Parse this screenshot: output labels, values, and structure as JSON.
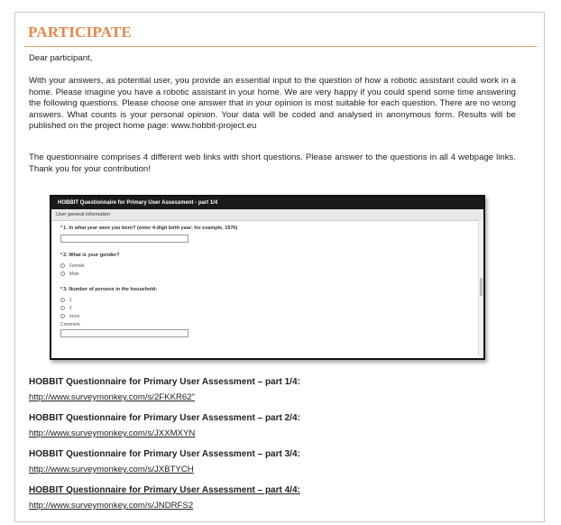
{
  "page": {
    "heading": "PARTICIPATE",
    "greeting": "Dear participant,",
    "intro": "With your answers, as potential user, you provide an essential input to the question of how a robotic assistant could work in a home. Please imagine you have a robotic assistant in your home. We are very happy if you could spend some time answering the following questions. Please choose one answer that in your opinion is most suitable for each question. There are no wrong answers. What counts is your personal opinion. Your data will be coded and analysed in anonymous form. Results will be published on the project home page: ",
    "intro_link": "www.hobbit-project.eu",
    "instructions": "The questionnaire comprises 4 different web links with short questions. Please answer to the questions in all 4 webpage links. Thank you for your contribution!"
  },
  "survey": {
    "title": "HOBBIT Questionnaire for Primary User Assessment - part 1/4",
    "section": "User general information",
    "q1": "1. In what year were you born? (enter 4-digit birth year; for example, 1976)",
    "q2": "2. What is your gender?",
    "q2_options": [
      "Female",
      "Male"
    ],
    "q3": "3. Number of persons in the household:",
    "q3_options": [
      "1",
      "2",
      "more"
    ],
    "comment_label": "Comment"
  },
  "links": [
    {
      "title": "HOBBIT Questionnaire for Primary User Assessment – part 1/4:",
      "url": "http://www.surveymonkey.com/s/2FKKR62\""
    },
    {
      "title": "HOBBIT Questionnaire for Primary User Assessment – part 2/4:",
      "url": "http://www.surveymonkey.com/s/JXXMXYN"
    },
    {
      "title": "HOBBIT Questionnaire for Primary User Assessment – part 3/4:",
      "url": "http://www.surveymonkey.com/s/JXBTYCH"
    },
    {
      "title": "HOBBIT Questionnaire for Primary User Assessment – part 4/4:",
      "url": "http://www.surveymonkey.com/s/JNDRFS2"
    }
  ],
  "colors": {
    "heading": "#e8874a",
    "rule": "#e8a070",
    "survey_header": "#1a1a1a"
  }
}
